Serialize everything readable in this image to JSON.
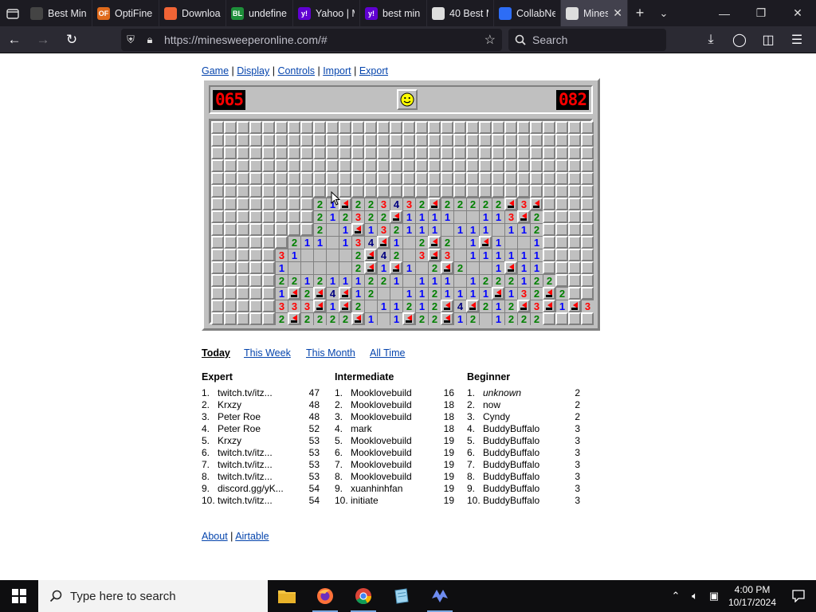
{
  "browser": {
    "tabs": [
      {
        "title": "Best Min",
        "favicon": "game-favicon",
        "color": "#444"
      },
      {
        "title": "OptiFine",
        "favicon": "OF",
        "color": "#e06a1b"
      },
      {
        "title": "Downloa",
        "favicon": "curseforge-favicon",
        "color": "#f16436"
      },
      {
        "title": "undefine",
        "favicon": "BL",
        "color": "#1e8f3a"
      },
      {
        "title": "Yahoo | M",
        "favicon": "y!",
        "color": "#6001d2"
      },
      {
        "title": "best min",
        "favicon": "y!",
        "color": "#6001d2"
      },
      {
        "title": "40 Best M",
        "favicon": "chrome-favicon",
        "color": "#ddd"
      },
      {
        "title": "CollabNe",
        "favicon": "search-favicon",
        "color": "#2d6df6"
      },
      {
        "title": "Mines",
        "favicon": "minesweeper-favicon",
        "color": "#ddd"
      }
    ],
    "active_tab": 8,
    "url": "https://minesweeperonline.com/#",
    "search_placeholder": "Search"
  },
  "top_menu": {
    "items": [
      "Game",
      "Display",
      "Controls",
      "Import",
      "Export"
    ],
    "separator": " | "
  },
  "game": {
    "mines_counter": "065",
    "timer": "082",
    "face": "smiley",
    "cols": 30,
    "rows": 16,
    "board": [
      "##############################",
      "##############################",
      "##############################",
      "##############################",
      "##############################",
      "##############################",
      "########21F223432F22222F3F####",
      "########212322F1111..113F2####",
      "########2.1F132111.111.112####",
      "######211.134F1.2F2.1F1..1####",
      "#####31....2F42.3F3.111111####",
      "#####1.....2F1F1.2F2..1F11####",
      "#####2212111221.111.1222122###",
      "#####1F2F4F12..1121111F132F2##",
      "#####333F1F2.11212F4F212F3F1F3",
      "#####2F2222F1.1F22F12.1222####"
    ]
  },
  "scores": {
    "periods": [
      "Today",
      "This Week",
      "This Month",
      "All Time"
    ],
    "active_period": "Today",
    "columns": [
      {
        "heading": "Expert",
        "entries": [
          {
            "rank": "1.",
            "name": "twitch.tv/itz...",
            "time": "47"
          },
          {
            "rank": "2.",
            "name": "Krxzy",
            "time": "48"
          },
          {
            "rank": "3.",
            "name": "Peter Roe",
            "time": "48"
          },
          {
            "rank": "4.",
            "name": "Peter Roe",
            "time": "52"
          },
          {
            "rank": "5.",
            "name": "Krxzy",
            "time": "53"
          },
          {
            "rank": "6.",
            "name": "twitch.tv/itz...",
            "time": "53"
          },
          {
            "rank": "7.",
            "name": "twitch.tv/itz...",
            "time": "53"
          },
          {
            "rank": "8.",
            "name": "twitch.tv/itz...",
            "time": "53"
          },
          {
            "rank": "9.",
            "name": "discord.gg/yK...",
            "time": "54"
          },
          {
            "rank": "10.",
            "name": "twitch.tv/itz...",
            "time": "54"
          }
        ]
      },
      {
        "heading": "Intermediate",
        "entries": [
          {
            "rank": "1.",
            "name": "Mooklovebuild",
            "time": "16"
          },
          {
            "rank": "2.",
            "name": "Mooklovebuild",
            "time": "18"
          },
          {
            "rank": "3.",
            "name": "Mooklovebuild",
            "time": "18"
          },
          {
            "rank": "4.",
            "name": "mark",
            "time": "18"
          },
          {
            "rank": "5.",
            "name": "Mooklovebuild",
            "time": "19"
          },
          {
            "rank": "6.",
            "name": "Mooklovebuild",
            "time": "19"
          },
          {
            "rank": "7.",
            "name": "Mooklovebuild",
            "time": "19"
          },
          {
            "rank": "8.",
            "name": "Mooklovebuild",
            "time": "19"
          },
          {
            "rank": "9.",
            "name": "xuanhinhfan",
            "time": "19"
          },
          {
            "rank": "10.",
            "name": "initiate",
            "time": "19"
          }
        ]
      },
      {
        "heading": "Beginner",
        "entries": [
          {
            "rank": "1.",
            "name": "unknown",
            "time": "2",
            "italic": true
          },
          {
            "rank": "2.",
            "name": "now",
            "time": "2"
          },
          {
            "rank": "3.",
            "name": "Cyndy",
            "time": "2"
          },
          {
            "rank": "4.",
            "name": "BuddyBuffalo",
            "time": "3"
          },
          {
            "rank": "5.",
            "name": "BuddyBuffalo",
            "time": "3"
          },
          {
            "rank": "6.",
            "name": "BuddyBuffalo",
            "time": "3"
          },
          {
            "rank": "7.",
            "name": "BuddyBuffalo",
            "time": "3"
          },
          {
            "rank": "8.",
            "name": "BuddyBuffalo",
            "time": "3"
          },
          {
            "rank": "9.",
            "name": "BuddyBuffalo",
            "time": "3"
          },
          {
            "rank": "10.",
            "name": "BuddyBuffalo",
            "time": "3"
          }
        ]
      }
    ]
  },
  "footer": {
    "about": "About",
    "airtable": "Airtable",
    "separator": " | "
  },
  "taskbar": {
    "search_placeholder": "Type here to search",
    "apps": [
      "file-explorer-icon",
      "firefox-icon",
      "chrome-icon",
      "notepad-icon",
      "game-app-icon"
    ],
    "time": "4:00 PM",
    "date": "10/17/2024"
  }
}
